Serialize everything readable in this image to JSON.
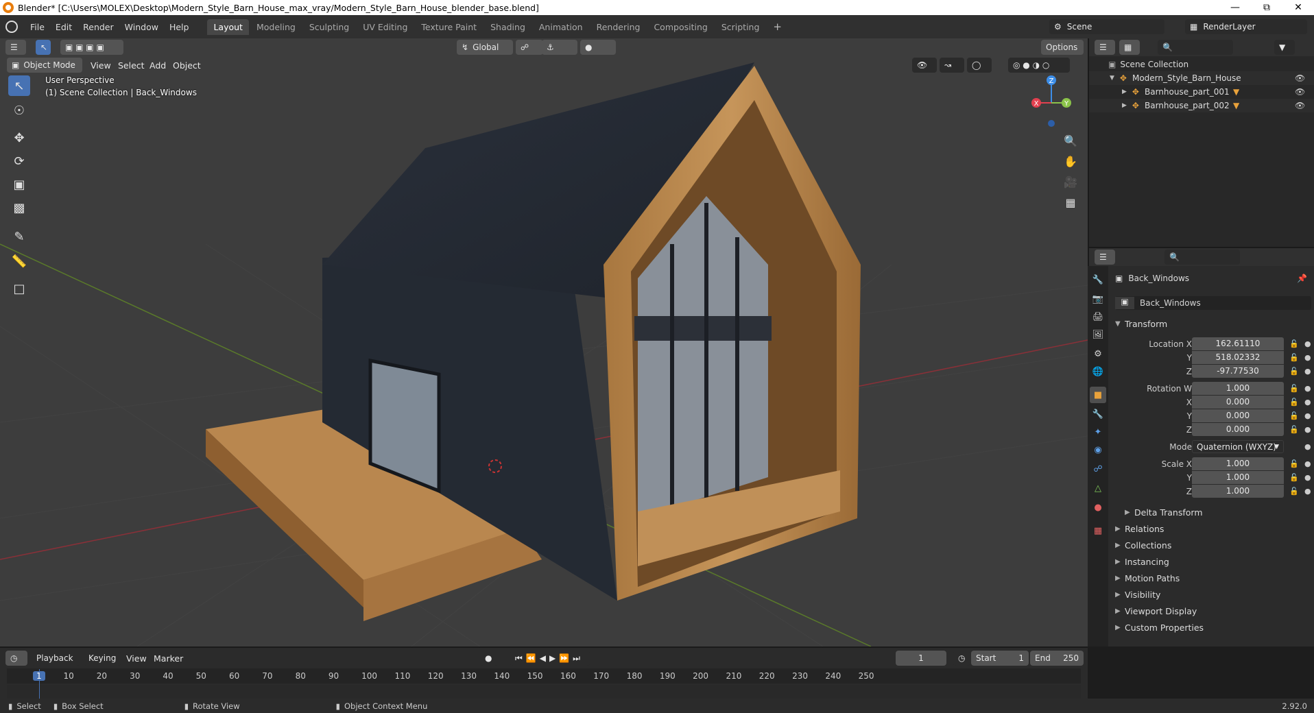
{
  "window": {
    "title": "Blender* [C:\\Users\\MOLEX\\Desktop\\Modern_Style_Barn_House_max_vray/Modern_Style_Barn_House_blender_base.blend]"
  },
  "menubar": {
    "menus": [
      "File",
      "Edit",
      "Render",
      "Window",
      "Help"
    ],
    "workspaces": [
      "Layout",
      "Modeling",
      "Sculpting",
      "UV Editing",
      "Texture Paint",
      "Shading",
      "Animation",
      "Rendering",
      "Compositing",
      "Scripting"
    ],
    "active_workspace": "Layout",
    "scene": "Scene",
    "render_layer": "RenderLayer"
  },
  "viewport": {
    "mode": "Object Mode",
    "menus": [
      "View",
      "Select",
      "Add",
      "Object"
    ],
    "orientation": "Global",
    "options_label": "Options",
    "perspective_label": "User Perspective",
    "collection_label": "(1) Scene Collection | Back_Windows",
    "gizmo_axes": {
      "z": "Z",
      "y": "Y",
      "x": "X"
    }
  },
  "outliner": {
    "root": "Scene Collection",
    "items": [
      {
        "name": "Modern_Style_Barn_House",
        "level": 1
      },
      {
        "name": "Barnhouse_part_001",
        "level": 2
      },
      {
        "name": "Barnhouse_part_002",
        "level": 2
      }
    ]
  },
  "properties": {
    "object_name": "Back_Windows",
    "data_name": "Back_Windows",
    "transform_label": "Transform",
    "location": {
      "label_x": "Location X",
      "label_y": "Y",
      "label_z": "Z",
      "x": "162.61110",
      "y": "518.02332",
      "z": "-97.77530"
    },
    "rotation": {
      "label_w": "Rotation W",
      "label_x": "X",
      "label_y": "Y",
      "label_z": "Z",
      "w": "1.000",
      "x": "0.000",
      "y": "0.000",
      "z": "0.000"
    },
    "mode": {
      "label": "Mode",
      "value": "Quaternion (WXYZ)"
    },
    "scale": {
      "label_x": "Scale X",
      "label_y": "Y",
      "label_z": "Z",
      "x": "1.000",
      "y": "1.000",
      "z": "1.000"
    },
    "delta_transform": "Delta Transform",
    "panels": [
      "Relations",
      "Collections",
      "Instancing",
      "Motion Paths",
      "Visibility",
      "Viewport Display",
      "Custom Properties"
    ]
  },
  "timeline": {
    "menus": [
      "Playback",
      "Keying",
      "View",
      "Marker"
    ],
    "current_frame": "1",
    "start_label": "Start",
    "start": "1",
    "end_label": "End",
    "end": "250",
    "ruler": [
      "1",
      "10",
      "20",
      "30",
      "40",
      "50",
      "60",
      "70",
      "80",
      "90",
      "100",
      "110",
      "120",
      "130",
      "140",
      "150",
      "160",
      "170",
      "180",
      "190",
      "200",
      "210",
      "220",
      "230",
      "240",
      "250"
    ]
  },
  "statusbar": {
    "select": "Select",
    "box_select": "Box Select",
    "rotate_view": "Rotate View",
    "context_menu": "Object Context Menu",
    "version": "2.92.0"
  },
  "colors": {
    "accent": "#4772b3",
    "viewport_bg": "#3d3d3d",
    "panel_bg": "#2b2b2b",
    "x_axis": "#e3404f",
    "y_axis": "#8bc34a",
    "z_axis": "#3d8ee8"
  }
}
